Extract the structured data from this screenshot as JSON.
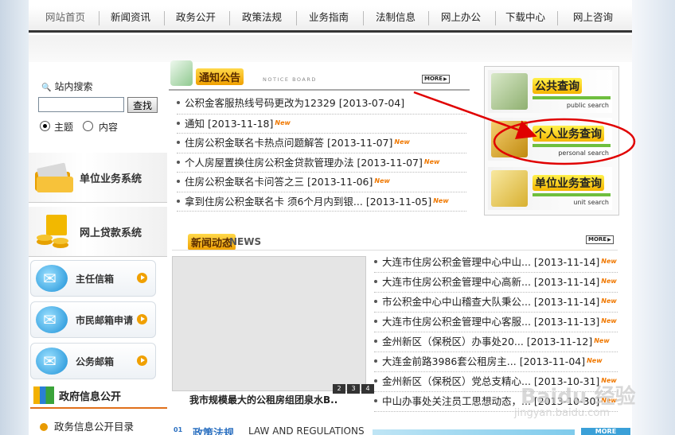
{
  "nav": {
    "items": [
      "网站首页",
      "新闻资讯",
      "政务公开",
      "政策法规",
      "业务指南",
      "法制信息",
      "网上办公",
      "下载中心",
      "网上咨询"
    ]
  },
  "search": {
    "label": "站内搜索",
    "placeholder": "",
    "button": "查找",
    "radio_title": "主题",
    "radio_content": "内容"
  },
  "systems": {
    "unit": "单位业务系统",
    "loan": "网上贷款系统"
  },
  "mailboxes": [
    "主任信箱",
    "市民邮箱申请",
    "公务邮箱"
  ],
  "gov": {
    "title": "政府信息公开",
    "sub": "政务信息公开目录"
  },
  "notice": {
    "title": "通知公告",
    "subtitle": "NOTICE BOARD",
    "more": "MORE",
    "items": [
      {
        "text": "公积金客服热线号码更改为12329 [2013-07-04]",
        "new": false
      },
      {
        "text": "通知 [2013-11-18]",
        "new": true
      },
      {
        "text": "住房公积金联名卡热点问题解答 [2013-11-07]",
        "new": true
      },
      {
        "text": "个人房屋置换住房公积金贷款管理办法 [2013-11-07]",
        "new": true
      },
      {
        "text": "住房公积金联名卡问答之三 [2013-11-06]",
        "new": true
      },
      {
        "text": "拿到住房公积金联名卡 须6个月内到银... [2013-11-05]",
        "new": true
      }
    ],
    "new_label": "New"
  },
  "query": {
    "items": [
      {
        "title": "公共查询",
        "en": "public search"
      },
      {
        "title": "个人业务查询",
        "en": "personal search"
      },
      {
        "title": "单位业务查询",
        "en": "unit search"
      }
    ]
  },
  "news": {
    "title": "新闻动态",
    "en": "NEWS",
    "more": "MORE",
    "photo_caption": "我市规模最大的公租房组团泉水B..",
    "pages": [
      "2",
      "3",
      "4"
    ],
    "items": [
      "大连市住房公积金管理中心中山... [2013-11-14]",
      "大连市住房公积金管理中心高新... [2013-11-14]",
      "市公积金中心中山稽查大队秉公... [2013-11-14]",
      "大连市住房公积金管理中心客服... [2013-11-13]",
      "金州新区（保税区）办事处20... [2013-11-12]",
      "大连金前路3986套公租房主... [2013-11-04]",
      "金州新区（保税区）党总支精心... [2013-10-31]",
      "中山办事处关注员工思想动态，... [2013-10-30]"
    ]
  },
  "law": {
    "num": "01",
    "title": "政策法规",
    "en": "LAW AND REGULATIONS",
    "more": "MORE"
  },
  "watermark": {
    "main": "Baidu 经验",
    "url": "jingyan.baidu.com"
  },
  "colors": {
    "accent_orange": "#f0a000",
    "annotation_red": "#e00000",
    "link_blue": "#2a6fc0"
  }
}
